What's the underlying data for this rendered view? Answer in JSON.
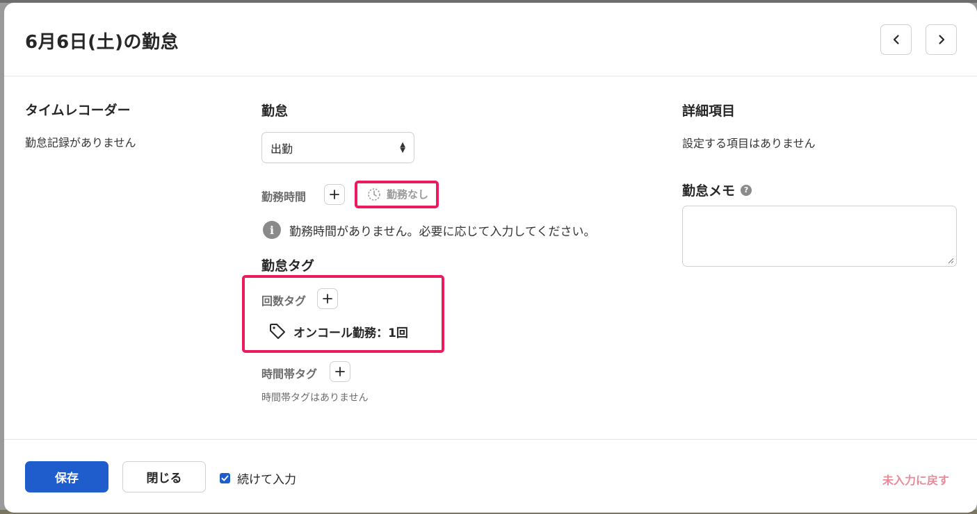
{
  "header": {
    "title": "6月6日(土)の勤怠"
  },
  "time_recorder": {
    "heading": "タイムレコーダー",
    "empty_text": "勤怠記録がありません"
  },
  "attendance": {
    "heading": "勤怠",
    "select_value": "出勤",
    "work_time_label": "勤務時間",
    "no_work_label": "勤務なし",
    "info_text": "勤務時間がありません。必要に応じて入力してください。",
    "tags_heading": "勤怠タグ",
    "count_tag_label": "回数タグ",
    "count_tag_item": "オンコール勤務：1回",
    "timeband_tag_label": "時間帯タグ",
    "timeband_empty": "時間帯タグはありません"
  },
  "details": {
    "heading": "詳細項目",
    "empty_text": "設定する項目はありません",
    "memo_heading": "勤怠メモ",
    "memo_value": ""
  },
  "footer": {
    "save_label": "保存",
    "close_label": "閉じる",
    "continue_label": "続けて入力",
    "continue_checked": true,
    "revert_label": "未入力に戻す"
  },
  "colors": {
    "primary": "#1f5ccc",
    "highlight": "#ee1a5e",
    "revert": "#e88a9a"
  }
}
